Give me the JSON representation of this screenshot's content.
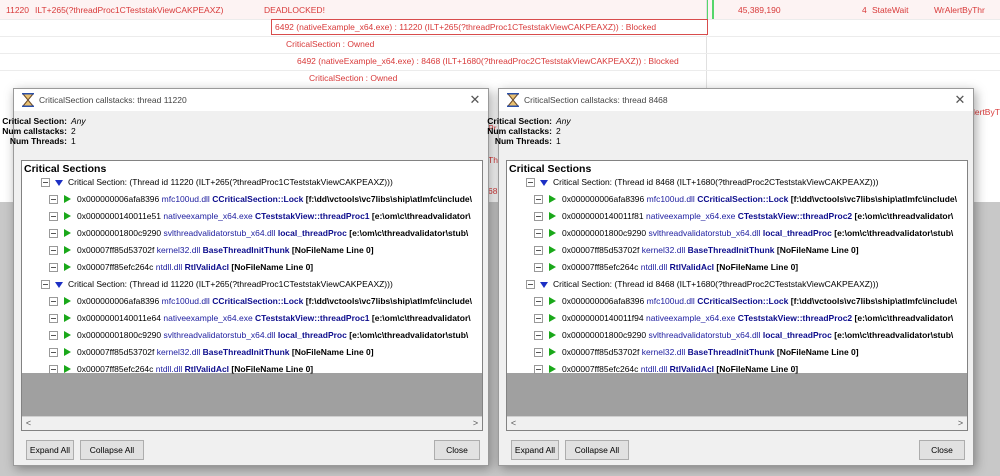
{
  "background": {
    "row0": {
      "tid": "11220",
      "func": "ILT+265(?threadProc1CTeststakViewCAKPEAXZ)",
      "status": "DEADLOCKED!",
      "count": "45,389,190",
      "num": "4",
      "state": "StateWait",
      "wait": "WrAlertByThr"
    },
    "box_text": "6492 (nativeExample_x64.exe) : 11220 (ILT+265(?threadProc1CTeststakViewCAKPEAXZ)) : Blocked",
    "cs_owned_1": "CriticalSection : Owned",
    "blocked_2": "6492 (nativeExample_x64.exe) : 8468 (ILT+1680(?threadProc2CTeststakViewCAKPEAXZ)) : Blocked",
    "cs_owned_2": "CriticalSection : Owned",
    "peek_pr": "Pr",
    "peek_th": "Th",
    "peek_68": "68",
    "peek_right": "lertByThr"
  },
  "dialogs": [
    {
      "title": "CriticalSection callstacks: thread 11220",
      "info": {
        "cs_label": "Critical Section:",
        "cs_value": "Any",
        "num_cs_label": "Num callstacks:",
        "num_cs_value": "2",
        "num_thr_label": "Num Threads:",
        "num_thr_value": "1"
      },
      "tree_header": "Critical Sections",
      "groups": [
        {
          "label": "Critical Section: (Thread id 11220 (ILT+265(?threadProc1CTeststakViewCAKPEAXZ)))",
          "frames": [
            {
              "addr": "0x000000006afa8396",
              "mod": "mfc100ud.dll",
              "fn": "CCriticalSection::Lock",
              "src": "[f:\\dd\\vctools\\vc7libs\\ship\\atlmfc\\include\\"
            },
            {
              "addr": "0x0000000140011e51",
              "mod": "nativeexample_x64.exe",
              "fn": "CTeststakView::threadProc1",
              "src": "[e:\\om\\c\\threadvalidator\\"
            },
            {
              "addr": "0x00000001800c9290",
              "mod": "svlthreadvalidatorstub_x64.dll",
              "fn": "local_threadProc",
              "src": "[e:\\om\\c\\threadvalidator\\stub\\"
            },
            {
              "addr": "0x00007ff85d53702f",
              "mod": "kernel32.dll",
              "fn": "BaseThreadInitThunk",
              "src": "[NoFileName Line 0]"
            },
            {
              "addr": "0x00007ff85efc264c",
              "mod": "ntdll.dll",
              "fn": "RtlValidAcl",
              "src": "[NoFileName Line 0]"
            }
          ]
        },
        {
          "label": "Critical Section: (Thread id 11220 (ILT+265(?threadProc1CTeststakViewCAKPEAXZ)))",
          "frames": [
            {
              "addr": "0x000000006afa8396",
              "mod": "mfc100ud.dll",
              "fn": "CCriticalSection::Lock",
              "src": "[f:\\dd\\vctools\\vc7libs\\ship\\atlmfc\\include\\"
            },
            {
              "addr": "0x0000000140011e64",
              "mod": "nativeexample_x64.exe",
              "fn": "CTeststakView::threadProc1",
              "src": "[e:\\om\\c\\threadvalidator\\"
            },
            {
              "addr": "0x00000001800c9290",
              "mod": "svlthreadvalidatorstub_x64.dll",
              "fn": "local_threadProc",
              "src": "[e:\\om\\c\\threadvalidator\\stub\\"
            },
            {
              "addr": "0x00007ff85d53702f",
              "mod": "kernel32.dll",
              "fn": "BaseThreadInitThunk",
              "src": "[NoFileName Line 0]"
            },
            {
              "addr": "0x00007ff85efc264c",
              "mod": "ntdll.dll",
              "fn": "RtlValidAcl",
              "src": "[NoFileName Line 0]"
            }
          ]
        }
      ],
      "buttons": {
        "expand": "Expand All",
        "collapse": "Collapse All",
        "close": "Close"
      }
    },
    {
      "title": "CriticalSection callstacks: thread 8468",
      "info": {
        "cs_label": "Critical Section:",
        "cs_value": "Any",
        "num_cs_label": "Num callstacks:",
        "num_cs_value": "2",
        "num_thr_label": "Num Threads:",
        "num_thr_value": "1"
      },
      "tree_header": "Critical Sections",
      "groups": [
        {
          "label": "Critical Section: (Thread id 8468 (ILT+1680(?threadProc2CTeststakViewCAKPEAXZ)))",
          "frames": [
            {
              "addr": "0x000000006afa8396",
              "mod": "mfc100ud.dll",
              "fn": "CCriticalSection::Lock",
              "src": "[f:\\dd\\vctools\\vc7libs\\ship\\atlmfc\\include\\"
            },
            {
              "addr": "0x0000000140011f81",
              "mod": "nativeexample_x64.exe",
              "fn": "CTeststakView::threadProc2",
              "src": "[e:\\om\\c\\threadvalidator\\"
            },
            {
              "addr": "0x00000001800c9290",
              "mod": "svlthreadvalidatorstub_x64.dll",
              "fn": "local_threadProc",
              "src": "[e:\\om\\c\\threadvalidator\\stub\\"
            },
            {
              "addr": "0x00007ff85d53702f",
              "mod": "kernel32.dll",
              "fn": "BaseThreadInitThunk",
              "src": "[NoFileName Line 0]"
            },
            {
              "addr": "0x00007ff85efc264c",
              "mod": "ntdll.dll",
              "fn": "RtlValidAcl",
              "src": "[NoFileName Line 0]"
            }
          ]
        },
        {
          "label": "Critical Section: (Thread id 8468 (ILT+1680(?threadProc2CTeststakViewCAKPEAXZ)))",
          "frames": [
            {
              "addr": "0x000000006afa8396",
              "mod": "mfc100ud.dll",
              "fn": "CCriticalSection::Lock",
              "src": "[f:\\dd\\vctools\\vc7libs\\ship\\atlmfc\\include\\"
            },
            {
              "addr": "0x0000000140011f94",
              "mod": "nativeexample_x64.exe",
              "fn": "CTeststakView::threadProc2",
              "src": "[e:\\om\\c\\threadvalidator\\"
            },
            {
              "addr": "0x00000001800c9290",
              "mod": "svlthreadvalidatorstub_x64.dll",
              "fn": "local_threadProc",
              "src": "[e:\\om\\c\\threadvalidator\\stub\\"
            },
            {
              "addr": "0x00007ff85d53702f",
              "mod": "kernel32.dll",
              "fn": "BaseThreadInitThunk",
              "src": "[NoFileName Line 0]"
            },
            {
              "addr": "0x00007ff85efc264c",
              "mod": "ntdll.dll",
              "fn": "RtlValidAcl",
              "src": "[NoFileName Line 0]"
            }
          ]
        }
      ],
      "buttons": {
        "expand": "Expand All",
        "collapse": "Collapse All",
        "close": "Close"
      }
    }
  ]
}
